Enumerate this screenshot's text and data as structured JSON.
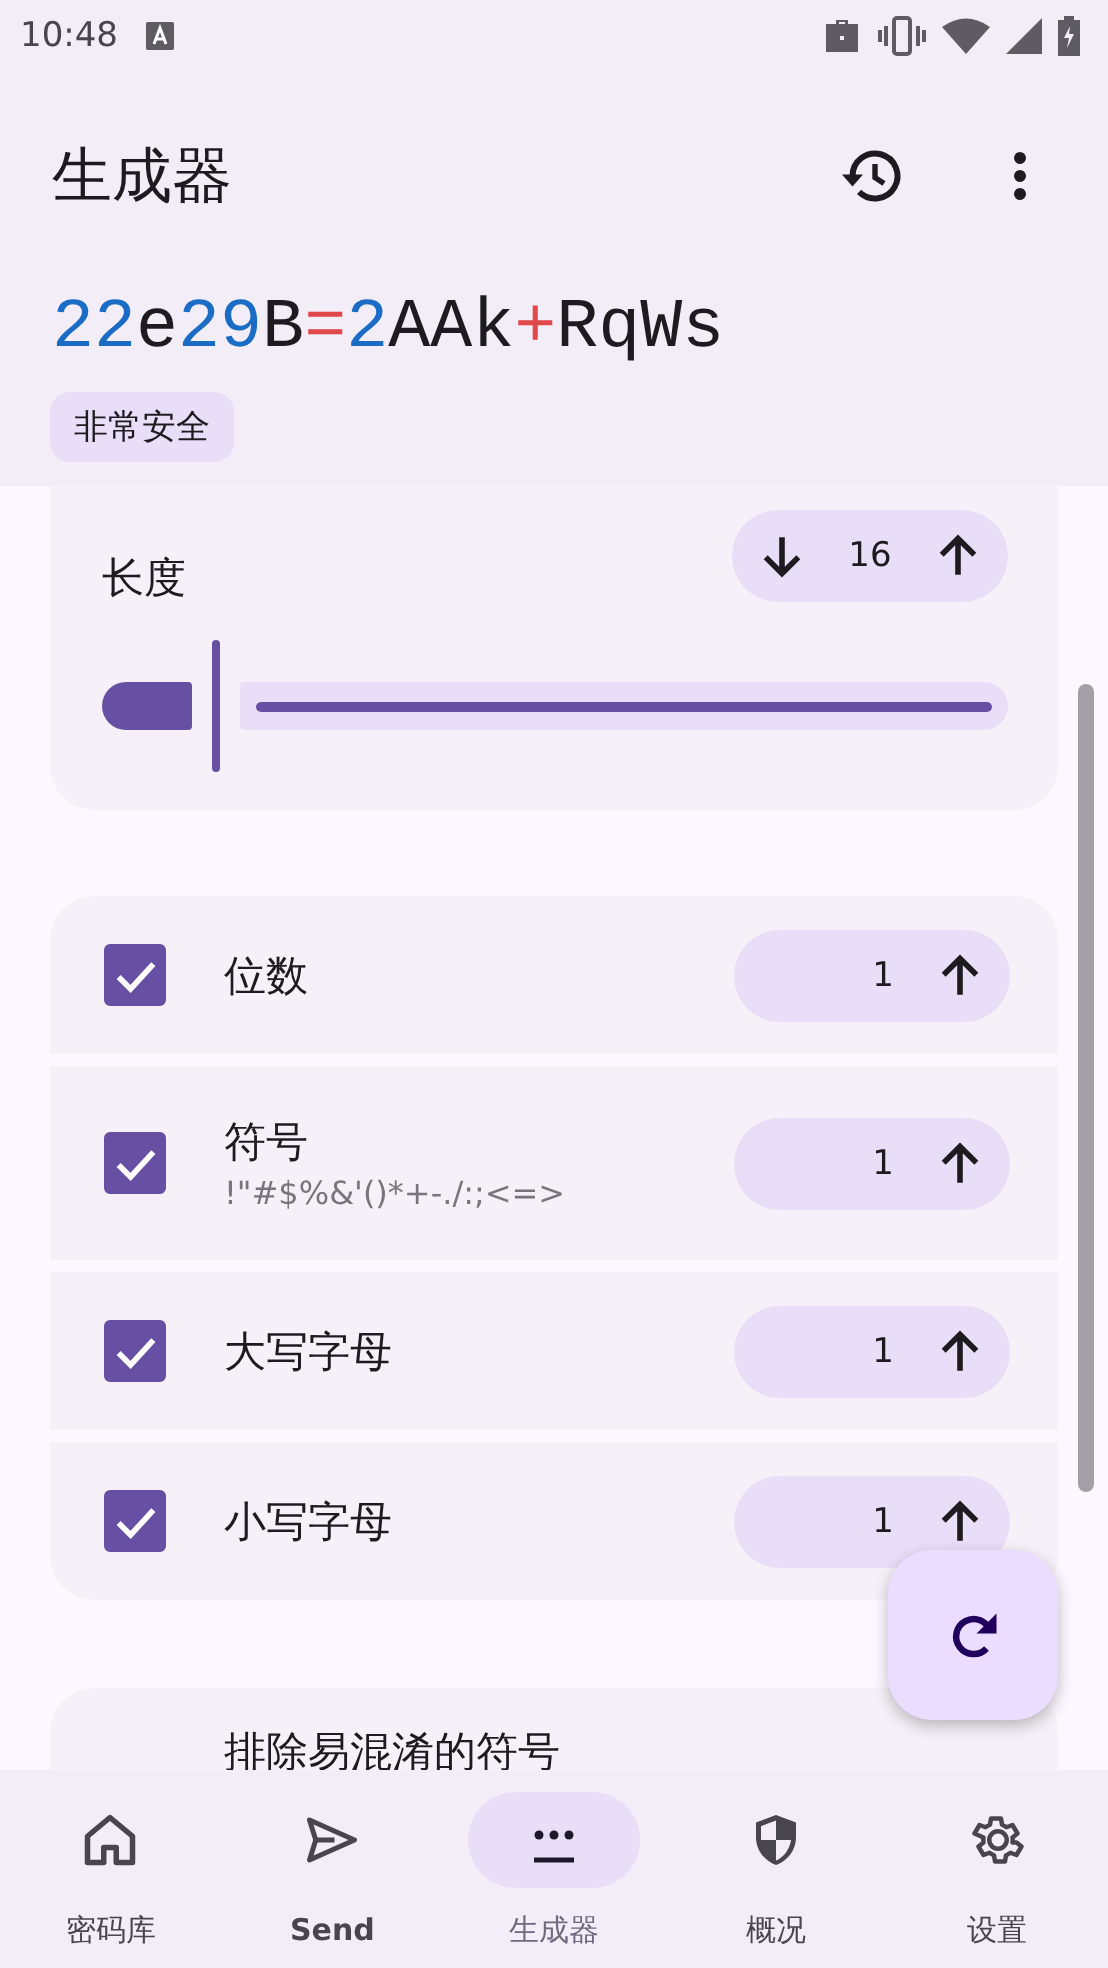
{
  "status_bar": {
    "time": "10:48"
  },
  "app_bar": {
    "title": "生成器"
  },
  "password": {
    "segments": [
      {
        "text": "22",
        "kind": "digit"
      },
      {
        "text": "e",
        "kind": "letter"
      },
      {
        "text": "29",
        "kind": "digit"
      },
      {
        "text": "B",
        "kind": "letter"
      },
      {
        "text": "=",
        "kind": "symbol"
      },
      {
        "text": "2",
        "kind": "digit"
      },
      {
        "text": "AAk",
        "kind": "letter"
      },
      {
        "text": "+",
        "kind": "symbol"
      },
      {
        "text": "RqWs",
        "kind": "letter"
      }
    ]
  },
  "strength_badge": "非常安全",
  "length": {
    "label": "长度",
    "value": "16",
    "can_decrease": true,
    "level": 0.1
  },
  "options": [
    {
      "label": "位数",
      "checked": true,
      "value": "1",
      "can_decrease": false
    },
    {
      "label": "符号",
      "subtitle": "!\"#$%&'()*+-./:;<=>",
      "checked": true,
      "value": "1",
      "can_decrease": false
    },
    {
      "label": "大写字母",
      "checked": true,
      "value": "1",
      "can_decrease": false
    },
    {
      "label": "小写字母",
      "checked": true,
      "value": "1",
      "can_decrease": false
    }
  ],
  "extra_option": {
    "label": "排除易混淆的符号"
  },
  "nav": [
    {
      "label": "密码库",
      "selected": false
    },
    {
      "label": "Send",
      "selected": false
    },
    {
      "label": "生成器",
      "selected": true
    },
    {
      "label": "概况",
      "selected": false
    },
    {
      "label": "设置",
      "selected": false
    }
  ]
}
